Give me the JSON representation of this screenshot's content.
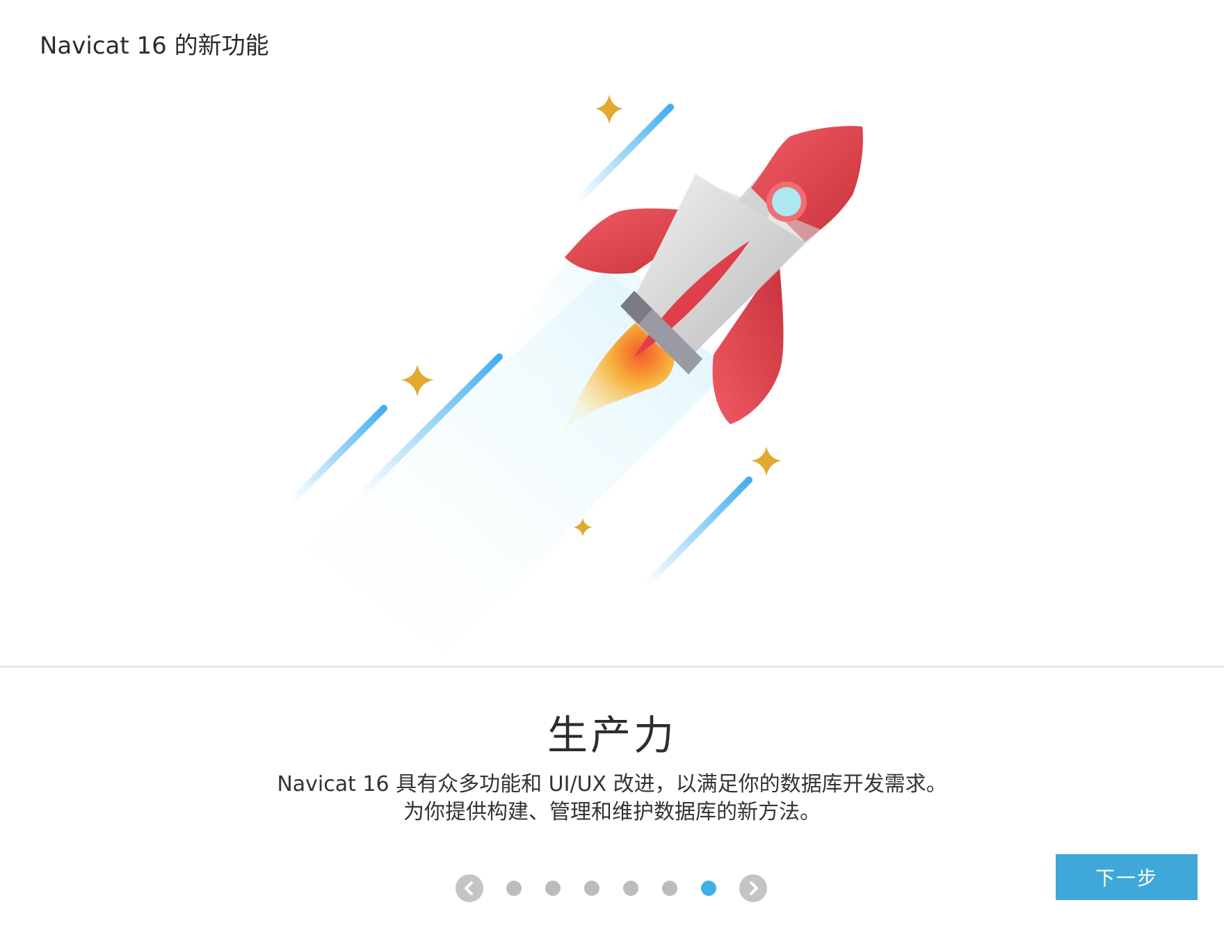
{
  "window": {
    "title": "Navicat 16 的新功能"
  },
  "slide": {
    "title": "生产力",
    "description_line1": "Navicat 16 具有众多功能和 UI/UX 改进，以满足你的数据库开发需求。",
    "description_line2": "为你提供构建、管理和维护数据库的新方法。",
    "illustration_icon": "rocket-icon"
  },
  "pager": {
    "total_pages": 7,
    "current_page": 7,
    "prev_icon": "chevron-left-icon",
    "next_icon": "chevron-right-icon"
  },
  "buttons": {
    "next_label": "下一步"
  },
  "colors": {
    "accent": "#3fa8d8",
    "active_dot": "#3fb0e3",
    "inactive_dot": "#bcbcbc",
    "arrow_bg": "#c4c4c4",
    "rocket_red": "#e0464f",
    "rocket_body": "#d8d8d8",
    "star_gold": "#e1a92f",
    "streak_blue": "#4ab2ec"
  }
}
